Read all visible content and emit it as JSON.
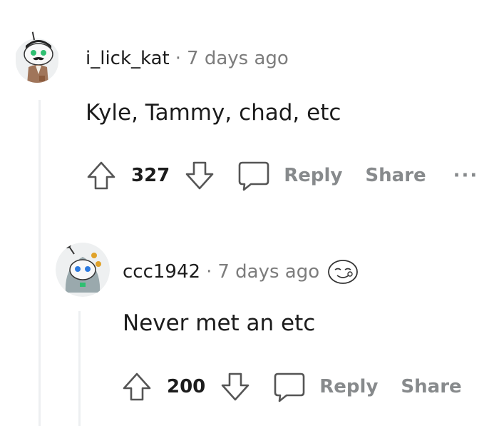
{
  "comments": [
    {
      "username": "i_lick_kat",
      "separator": "·",
      "time": "7 days ago",
      "body": "Kyle, Tammy, chad, etc",
      "score": "327",
      "reply_label": "Reply",
      "share_label": "Share",
      "more_label": "···"
    },
    {
      "username": "ccc1942",
      "separator": "·",
      "time": "7 days ago",
      "body": "Never met an etc",
      "score": "200",
      "reply_label": "Reply",
      "share_label": "Share"
    }
  ],
  "colors": {
    "text": "#1c1c1c",
    "muted": "#7c7c7c",
    "action": "#878a8c",
    "threadline": "#edeff1"
  }
}
